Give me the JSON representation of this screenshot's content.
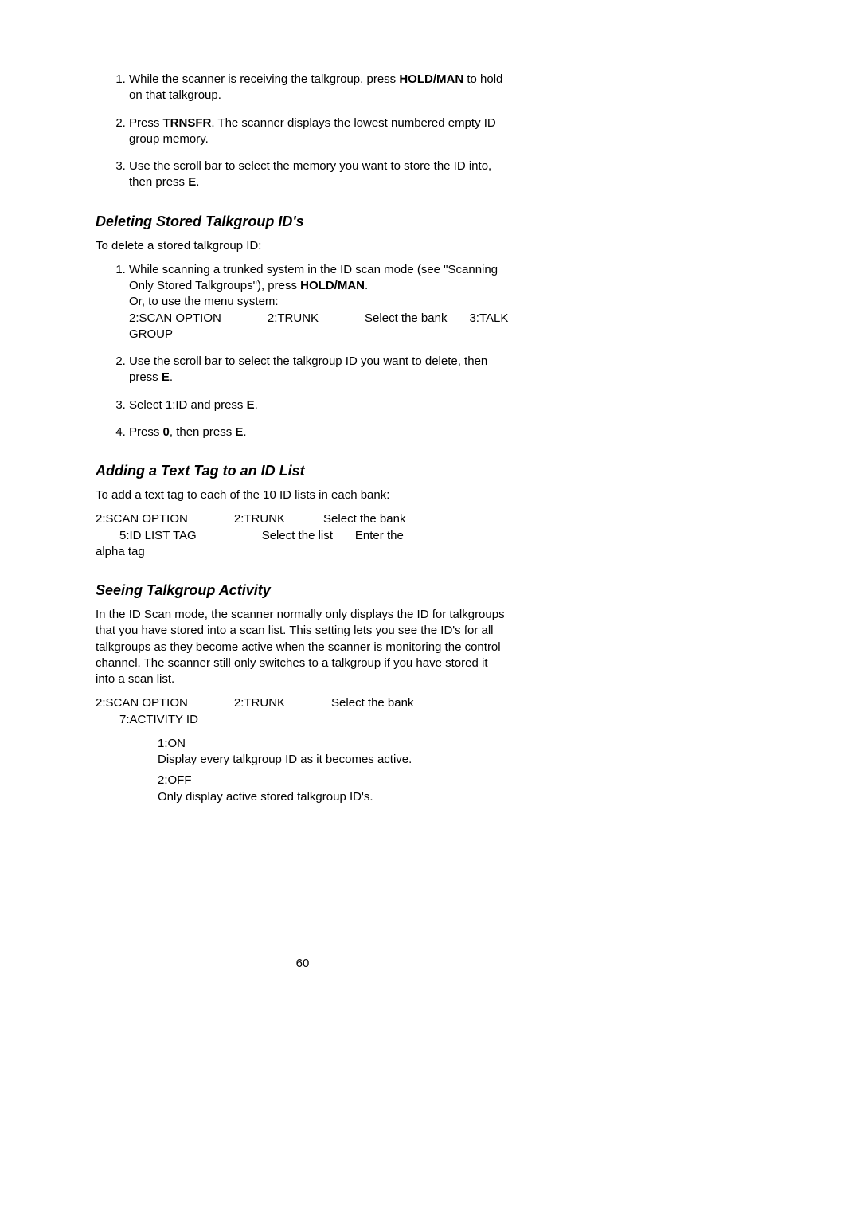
{
  "top_steps": [
    {
      "pre": "While the scanner is receiving the talkgroup, press ",
      "b": "HOLD/MAN",
      "post": " to hold on that talkgroup."
    },
    {
      "pre": "Press ",
      "b": "TRNSFR",
      "post": ". The scanner displays the lowest numbered empty ID group memory."
    },
    {
      "pre": "Use the scroll bar to select the memory you want to store the ID into, then press ",
      "b": "E",
      "post": "."
    }
  ],
  "deleting": {
    "heading": "Deleting Stored Talkgroup ID's",
    "lead": "To delete a stored talkgroup ID:",
    "step1": {
      "line1a": "While scanning a trunked system in the ID scan mode (see \"Scanning Only Stored Talkgroups\"), press ",
      "line1b": "HOLD/MAN",
      "line1c": ".",
      "line2": "Or, to use the menu system:",
      "seg_a": "2:SCAN OPTION",
      "seg_b": "2:TRUNK",
      "seg_c": "Select the bank",
      "seg_d": "3:TALK GROUP"
    },
    "step2": {
      "pre": "Use the scroll bar to select the talkgroup ID you want to delete, then press ",
      "b": "E",
      "post": "."
    },
    "step3": {
      "pre": "Select 1:ID and press ",
      "b": "E",
      "post": "."
    },
    "step4": {
      "pre": "Press ",
      "b1": "0",
      "mid": ", then press ",
      "b2": "E",
      "post": "."
    }
  },
  "adding": {
    "heading": "Adding a Text Tag to an ID List",
    "lead": "To add a text tag to each of the 10 ID lists in each bank:",
    "seg_a": "2:SCAN OPTION",
    "seg_b": "2:TRUNK",
    "seg_c": "Select the bank",
    "seg_d": "5:ID LIST TAG",
    "seg_e": "Select the list",
    "seg_f": "Enter the",
    "seg_g": "alpha tag"
  },
  "seeing": {
    "heading": "Seeing Talkgroup Activity",
    "para": "In the ID Scan mode, the scanner normally only displays the ID for talkgroups that you have stored into a scan list. This setting lets you see the ID's for all talkgroups as they become active when the scanner is monitoring the control channel. The scanner still only switches to a talkgroup if you have stored it into a scan list.",
    "seg_a": "2:SCAN OPTION",
    "seg_b": "2:TRUNK",
    "seg_c": "Select the bank",
    "seg_d": "7:ACTIVITY ID",
    "opt1_label": "1:ON",
    "opt1_desc": "Display every talkgroup ID as it becomes active.",
    "opt2_label": "2:OFF",
    "opt2_desc": "Only display active stored talkgroup ID's."
  },
  "page_number": "60"
}
